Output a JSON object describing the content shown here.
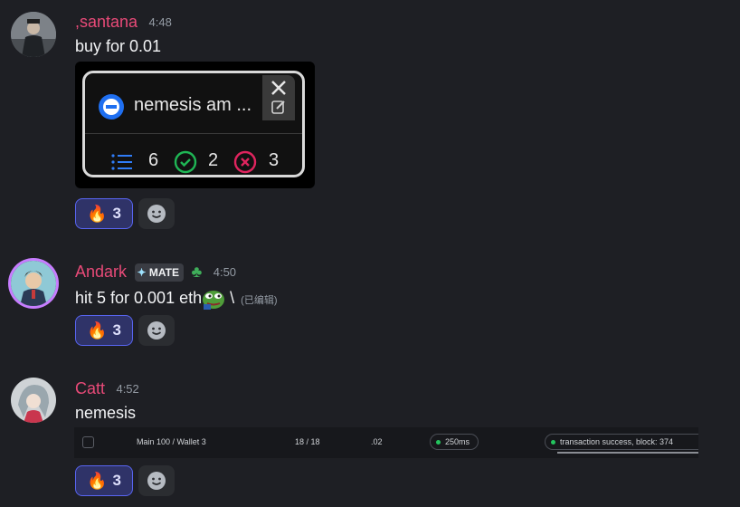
{
  "messages": [
    {
      "username": ",santana",
      "time": "4:48",
      "text": "buy for 0.01",
      "embed": {
        "title": "nemesis am ...",
        "stats": [
          {
            "icon": "list-icon",
            "value": "6",
            "color": "#2f7cf6"
          },
          {
            "icon": "check-circle-icon",
            "value": "2",
            "color": "#1fb655"
          },
          {
            "icon": "x-circle-icon",
            "value": "3",
            "color": "#e0245e"
          }
        ]
      },
      "reaction": {
        "emoji": "🔥",
        "count": "3"
      }
    },
    {
      "username": "Andark",
      "badge": "MATE",
      "time": "4:50",
      "text": "hit 5 for 0.001 eth",
      "text_suffix": "\\",
      "edited": "(已编辑)",
      "reaction": {
        "emoji": "🔥",
        "count": "3"
      }
    },
    {
      "username": "Catt",
      "time": "4:52",
      "text": "nemesis",
      "table_row": {
        "name": "Main 100 / Wallet 3",
        "progress": "18 / 18",
        "amount": ".02",
        "latency": "250ms",
        "status": "transaction success, block: 374"
      },
      "reaction": {
        "emoji": "🔥",
        "count": "3"
      }
    }
  ],
  "colors": {
    "background": "#1e1f24",
    "username": "#e84a78",
    "reaction_active_bg": "#2f3368",
    "reaction_border": "#5865f2",
    "success_green": "#23c55e"
  }
}
